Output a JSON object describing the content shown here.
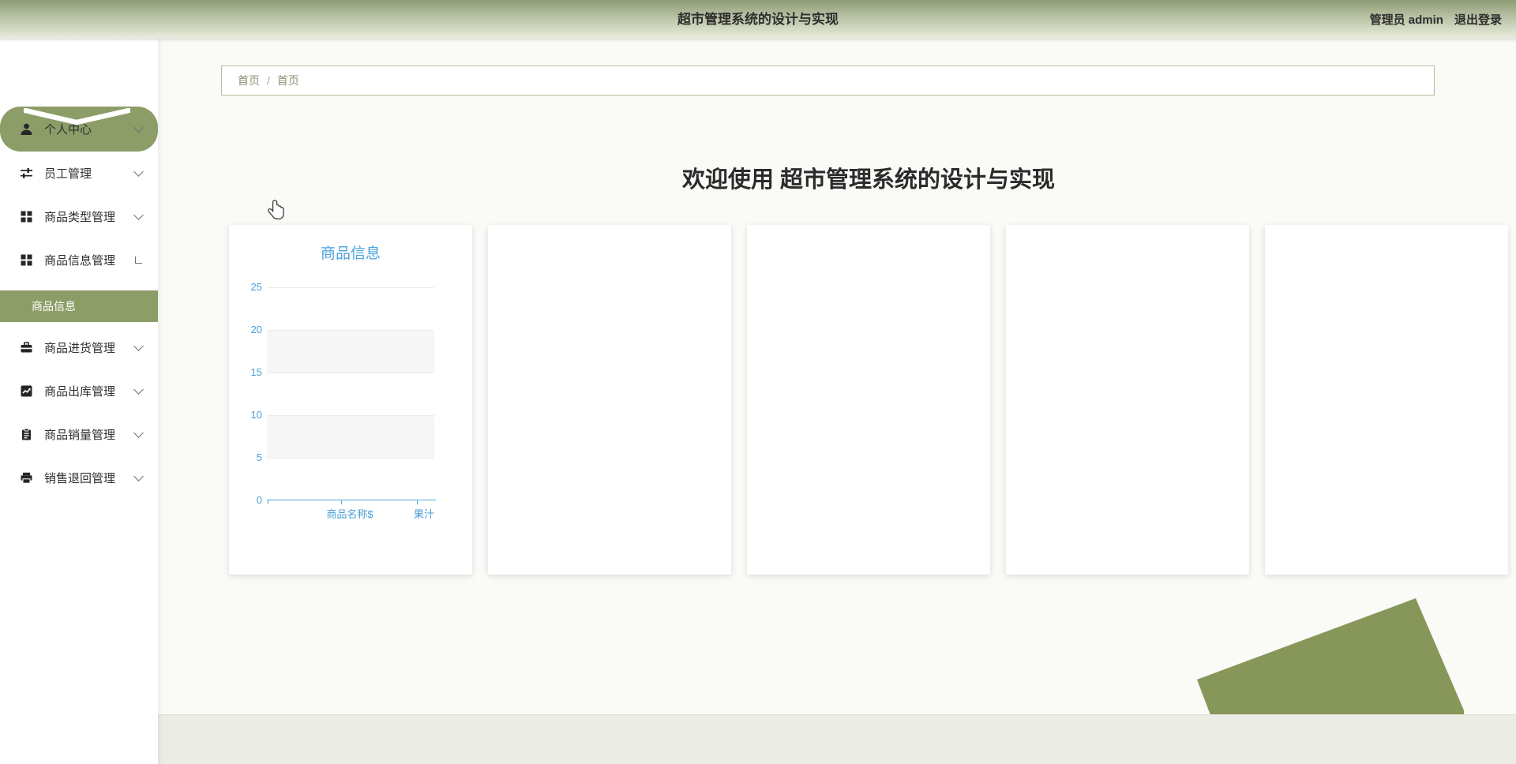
{
  "header": {
    "title": "超市管理系统的设计与实现",
    "user_role": "管理员",
    "username": "admin",
    "logout_label": "退出登录"
  },
  "breadcrumb": {
    "separator": "/",
    "items": [
      "首页",
      "首页"
    ]
  },
  "welcome_heading": "欢迎使用 超市管理系统的设计与实现",
  "sidebar": {
    "items": [
      {
        "key": "profile",
        "label": "个人中心",
        "icon": "user-icon",
        "chevron": "down",
        "state": "active"
      },
      {
        "key": "employee-mgmt",
        "label": "员工管理",
        "icon": "sliders-icon",
        "chevron": "down"
      },
      {
        "key": "product-type-mgmt",
        "label": "商品类型管理",
        "icon": "grid-icon",
        "chevron": "down"
      },
      {
        "key": "product-info-mgmt",
        "label": "商品信息管理",
        "icon": "grid-icon",
        "chevron": "expanded",
        "children": [
          {
            "key": "product-info",
            "label": "商品信息",
            "state": "active"
          }
        ]
      },
      {
        "key": "purchase-mgmt",
        "label": "商品进货管理",
        "icon": "briefcase-icon",
        "chevron": "down"
      },
      {
        "key": "outbound-mgmt",
        "label": "商品出库管理",
        "icon": "chart-icon",
        "chevron": "down"
      },
      {
        "key": "sales-volume-mgmt",
        "label": "商品销量管理",
        "icon": "clipboard-icon",
        "chevron": "down"
      },
      {
        "key": "sales-return-mgmt",
        "label": "销售退回管理",
        "icon": "printer-icon",
        "chevron": "down"
      }
    ]
  },
  "chart_data": {
    "type": "bar",
    "title": "商品信息",
    "categories": [
      "商品名称$",
      "果汁"
    ],
    "values": [
      0,
      0
    ],
    "xlabel": "",
    "ylabel": "",
    "ylim": [
      0,
      25
    ],
    "yticks": [
      25,
      20,
      15,
      10,
      5,
      0
    ],
    "grid": true,
    "split_area_bands": true,
    "legend_position": "none",
    "accent": "#4aa3df"
  },
  "colors": {
    "header_gradient_top": "#8d9c74",
    "header_gradient_bottom": "#eaecdd",
    "green_accent": "#8d9d68",
    "green_shape": "#87975a",
    "chart_accent": "#4aa3df",
    "breadcrumb_text": "#8b9070",
    "footer_bg": "#ebece4"
  }
}
